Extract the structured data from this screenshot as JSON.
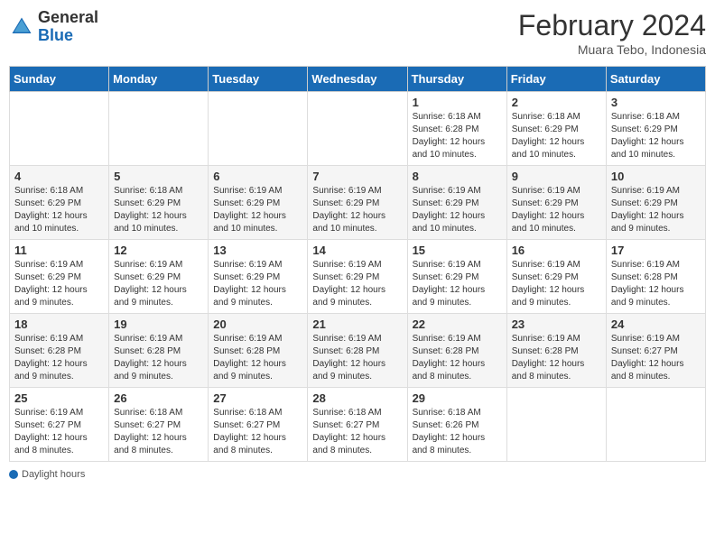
{
  "header": {
    "logo_general": "General",
    "logo_blue": "Blue",
    "month_year": "February 2024",
    "location": "Muara Tebo, Indonesia"
  },
  "days_of_week": [
    "Sunday",
    "Monday",
    "Tuesday",
    "Wednesday",
    "Thursday",
    "Friday",
    "Saturday"
  ],
  "weeks": [
    [
      {
        "day": "",
        "info": ""
      },
      {
        "day": "",
        "info": ""
      },
      {
        "day": "",
        "info": ""
      },
      {
        "day": "",
        "info": ""
      },
      {
        "day": "1",
        "info": "Sunrise: 6:18 AM\nSunset: 6:28 PM\nDaylight: 12 hours\nand 10 minutes."
      },
      {
        "day": "2",
        "info": "Sunrise: 6:18 AM\nSunset: 6:29 PM\nDaylight: 12 hours\nand 10 minutes."
      },
      {
        "day": "3",
        "info": "Sunrise: 6:18 AM\nSunset: 6:29 PM\nDaylight: 12 hours\nand 10 minutes."
      }
    ],
    [
      {
        "day": "4",
        "info": "Sunrise: 6:18 AM\nSunset: 6:29 PM\nDaylight: 12 hours\nand 10 minutes."
      },
      {
        "day": "5",
        "info": "Sunrise: 6:18 AM\nSunset: 6:29 PM\nDaylight: 12 hours\nand 10 minutes."
      },
      {
        "day": "6",
        "info": "Sunrise: 6:19 AM\nSunset: 6:29 PM\nDaylight: 12 hours\nand 10 minutes."
      },
      {
        "day": "7",
        "info": "Sunrise: 6:19 AM\nSunset: 6:29 PM\nDaylight: 12 hours\nand 10 minutes."
      },
      {
        "day": "8",
        "info": "Sunrise: 6:19 AM\nSunset: 6:29 PM\nDaylight: 12 hours\nand 10 minutes."
      },
      {
        "day": "9",
        "info": "Sunrise: 6:19 AM\nSunset: 6:29 PM\nDaylight: 12 hours\nand 10 minutes."
      },
      {
        "day": "10",
        "info": "Sunrise: 6:19 AM\nSunset: 6:29 PM\nDaylight: 12 hours\nand 9 minutes."
      }
    ],
    [
      {
        "day": "11",
        "info": "Sunrise: 6:19 AM\nSunset: 6:29 PM\nDaylight: 12 hours\nand 9 minutes."
      },
      {
        "day": "12",
        "info": "Sunrise: 6:19 AM\nSunset: 6:29 PM\nDaylight: 12 hours\nand 9 minutes."
      },
      {
        "day": "13",
        "info": "Sunrise: 6:19 AM\nSunset: 6:29 PM\nDaylight: 12 hours\nand 9 minutes."
      },
      {
        "day": "14",
        "info": "Sunrise: 6:19 AM\nSunset: 6:29 PM\nDaylight: 12 hours\nand 9 minutes."
      },
      {
        "day": "15",
        "info": "Sunrise: 6:19 AM\nSunset: 6:29 PM\nDaylight: 12 hours\nand 9 minutes."
      },
      {
        "day": "16",
        "info": "Sunrise: 6:19 AM\nSunset: 6:29 PM\nDaylight: 12 hours\nand 9 minutes."
      },
      {
        "day": "17",
        "info": "Sunrise: 6:19 AM\nSunset: 6:28 PM\nDaylight: 12 hours\nand 9 minutes."
      }
    ],
    [
      {
        "day": "18",
        "info": "Sunrise: 6:19 AM\nSunset: 6:28 PM\nDaylight: 12 hours\nand 9 minutes."
      },
      {
        "day": "19",
        "info": "Sunrise: 6:19 AM\nSunset: 6:28 PM\nDaylight: 12 hours\nand 9 minutes."
      },
      {
        "day": "20",
        "info": "Sunrise: 6:19 AM\nSunset: 6:28 PM\nDaylight: 12 hours\nand 9 minutes."
      },
      {
        "day": "21",
        "info": "Sunrise: 6:19 AM\nSunset: 6:28 PM\nDaylight: 12 hours\nand 9 minutes."
      },
      {
        "day": "22",
        "info": "Sunrise: 6:19 AM\nSunset: 6:28 PM\nDaylight: 12 hours\nand 8 minutes."
      },
      {
        "day": "23",
        "info": "Sunrise: 6:19 AM\nSunset: 6:28 PM\nDaylight: 12 hours\nand 8 minutes."
      },
      {
        "day": "24",
        "info": "Sunrise: 6:19 AM\nSunset: 6:27 PM\nDaylight: 12 hours\nand 8 minutes."
      }
    ],
    [
      {
        "day": "25",
        "info": "Sunrise: 6:19 AM\nSunset: 6:27 PM\nDaylight: 12 hours\nand 8 minutes."
      },
      {
        "day": "26",
        "info": "Sunrise: 6:18 AM\nSunset: 6:27 PM\nDaylight: 12 hours\nand 8 minutes."
      },
      {
        "day": "27",
        "info": "Sunrise: 6:18 AM\nSunset: 6:27 PM\nDaylight: 12 hours\nand 8 minutes."
      },
      {
        "day": "28",
        "info": "Sunrise: 6:18 AM\nSunset: 6:27 PM\nDaylight: 12 hours\nand 8 minutes."
      },
      {
        "day": "29",
        "info": "Sunrise: 6:18 AM\nSunset: 6:26 PM\nDaylight: 12 hours\nand 8 minutes."
      },
      {
        "day": "",
        "info": ""
      },
      {
        "day": "",
        "info": ""
      }
    ]
  ],
  "footer": {
    "daylight_label": "Daylight hours"
  }
}
